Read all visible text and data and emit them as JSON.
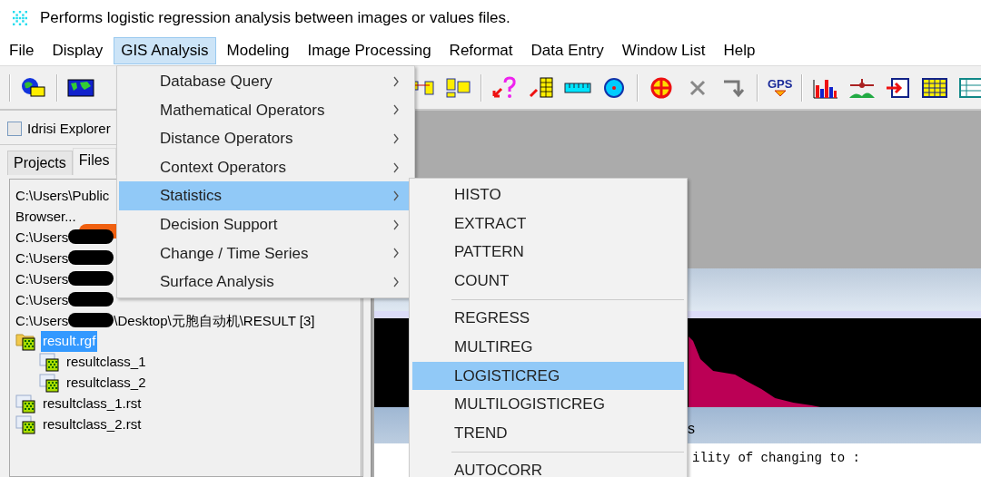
{
  "window": {
    "title": "Performs logistic regression analysis between images or values files."
  },
  "menubar": [
    {
      "label": "File",
      "selected": false
    },
    {
      "label": "Display",
      "selected": false
    },
    {
      "label": "GIS Analysis",
      "selected": true
    },
    {
      "label": "Modeling",
      "selected": false
    },
    {
      "label": "Image Processing",
      "selected": false
    },
    {
      "label": "Reformat",
      "selected": false
    },
    {
      "label": "Data Entry",
      "selected": false
    },
    {
      "label": "Window List",
      "selected": false
    },
    {
      "label": "Help",
      "selected": false
    }
  ],
  "toolbar": {
    "gps_label": "GPS"
  },
  "explorer": {
    "title": "Idrisi Explorer",
    "tabs": [
      {
        "label": "Projects",
        "selected": false
      },
      {
        "label": "Files",
        "selected": true
      }
    ],
    "paths": [
      {
        "text": "C:\\Users\\Public",
        "redacted": false
      },
      {
        "text": "Browser...",
        "redacted": false
      },
      {
        "text": "C:\\Users",
        "redacted": true
      },
      {
        "text": "C:\\Users",
        "redacted": true
      },
      {
        "text": "C:\\Users",
        "redacted": true
      },
      {
        "text": "C:\\Users",
        "redacted": true
      },
      {
        "text": "C:\\Users",
        "redacted": true,
        "suffix": "\\Desktop\\元胞自动机\\RESULT [3]"
      }
    ],
    "files": [
      {
        "name": "result.rgf",
        "kind": "group",
        "selected": true,
        "children": [
          {
            "name": "resultclass_1",
            "kind": "raster",
            "selected": false
          },
          {
            "name": "resultclass_2",
            "kind": "raster",
            "selected": false
          }
        ]
      },
      {
        "name": "resultclass_1.rst",
        "kind": "raster",
        "selected": false
      },
      {
        "name": "resultclass_2.rst",
        "kind": "raster",
        "selected": false
      }
    ]
  },
  "result_window": {
    "caption_fragment": "s",
    "text_fragment": "ility of changing to :"
  },
  "gis_menu": [
    {
      "label": "Database Query",
      "has_submenu": true,
      "selected": false
    },
    {
      "label": "Mathematical Operators",
      "has_submenu": true,
      "selected": false
    },
    {
      "label": "Distance Operators",
      "has_submenu": true,
      "selected": false
    },
    {
      "label": "Context Operators",
      "has_submenu": true,
      "selected": false
    },
    {
      "label": "Statistics",
      "has_submenu": true,
      "selected": true
    },
    {
      "label": "Decision Support",
      "has_submenu": true,
      "selected": false
    },
    {
      "label": "Change / Time Series",
      "has_submenu": true,
      "selected": false
    },
    {
      "label": "Surface Analysis",
      "has_submenu": true,
      "selected": false
    }
  ],
  "statistics_menu": [
    {
      "kind": "item",
      "label": "HISTO",
      "selected": false
    },
    {
      "kind": "item",
      "label": "EXTRACT",
      "selected": false
    },
    {
      "kind": "item",
      "label": "PATTERN",
      "selected": false
    },
    {
      "kind": "item",
      "label": "COUNT",
      "selected": false
    },
    {
      "kind": "separator"
    },
    {
      "kind": "item",
      "label": "REGRESS",
      "selected": false
    },
    {
      "kind": "item",
      "label": "MULTIREG",
      "selected": false
    },
    {
      "kind": "item",
      "label": "LOGISTICREG",
      "selected": true
    },
    {
      "kind": "item",
      "label": "MULTILOGISTICREG",
      "selected": false
    },
    {
      "kind": "item",
      "label": "TREND",
      "selected": false
    },
    {
      "kind": "separator"
    },
    {
      "kind": "item",
      "label": "AUTOCORR",
      "selected": false
    }
  ]
}
